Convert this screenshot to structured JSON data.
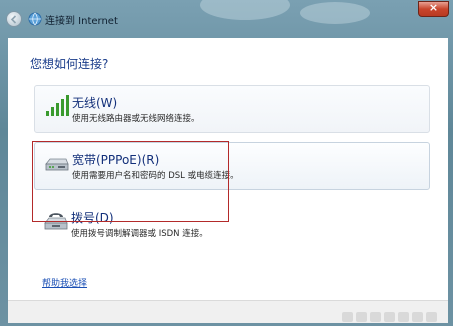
{
  "window": {
    "title": "连接到 Internet",
    "close_label": "×"
  },
  "main": {
    "heading": "您想如何连接?",
    "options": [
      {
        "title": "无线(W)",
        "description": "使用无线路由器或无线网络连接。",
        "icon": "wireless-signal-icon"
      },
      {
        "title": "宽带(PPPoE)(R)",
        "description": "使用需要用户名和密码的 DSL 或电缆连接。",
        "icon": "broadband-modem-icon"
      },
      {
        "title": "拨号(D)",
        "description": "使用拨号调制解调器或 ISDN 连接。",
        "icon": "dialup-phone-icon"
      }
    ],
    "help_link": "帮助我选择"
  },
  "colors": {
    "link": "#1a4fb5",
    "heading": "#1a3c8a",
    "highlight": "#b32a2a",
    "close_button": "#c8452c"
  }
}
